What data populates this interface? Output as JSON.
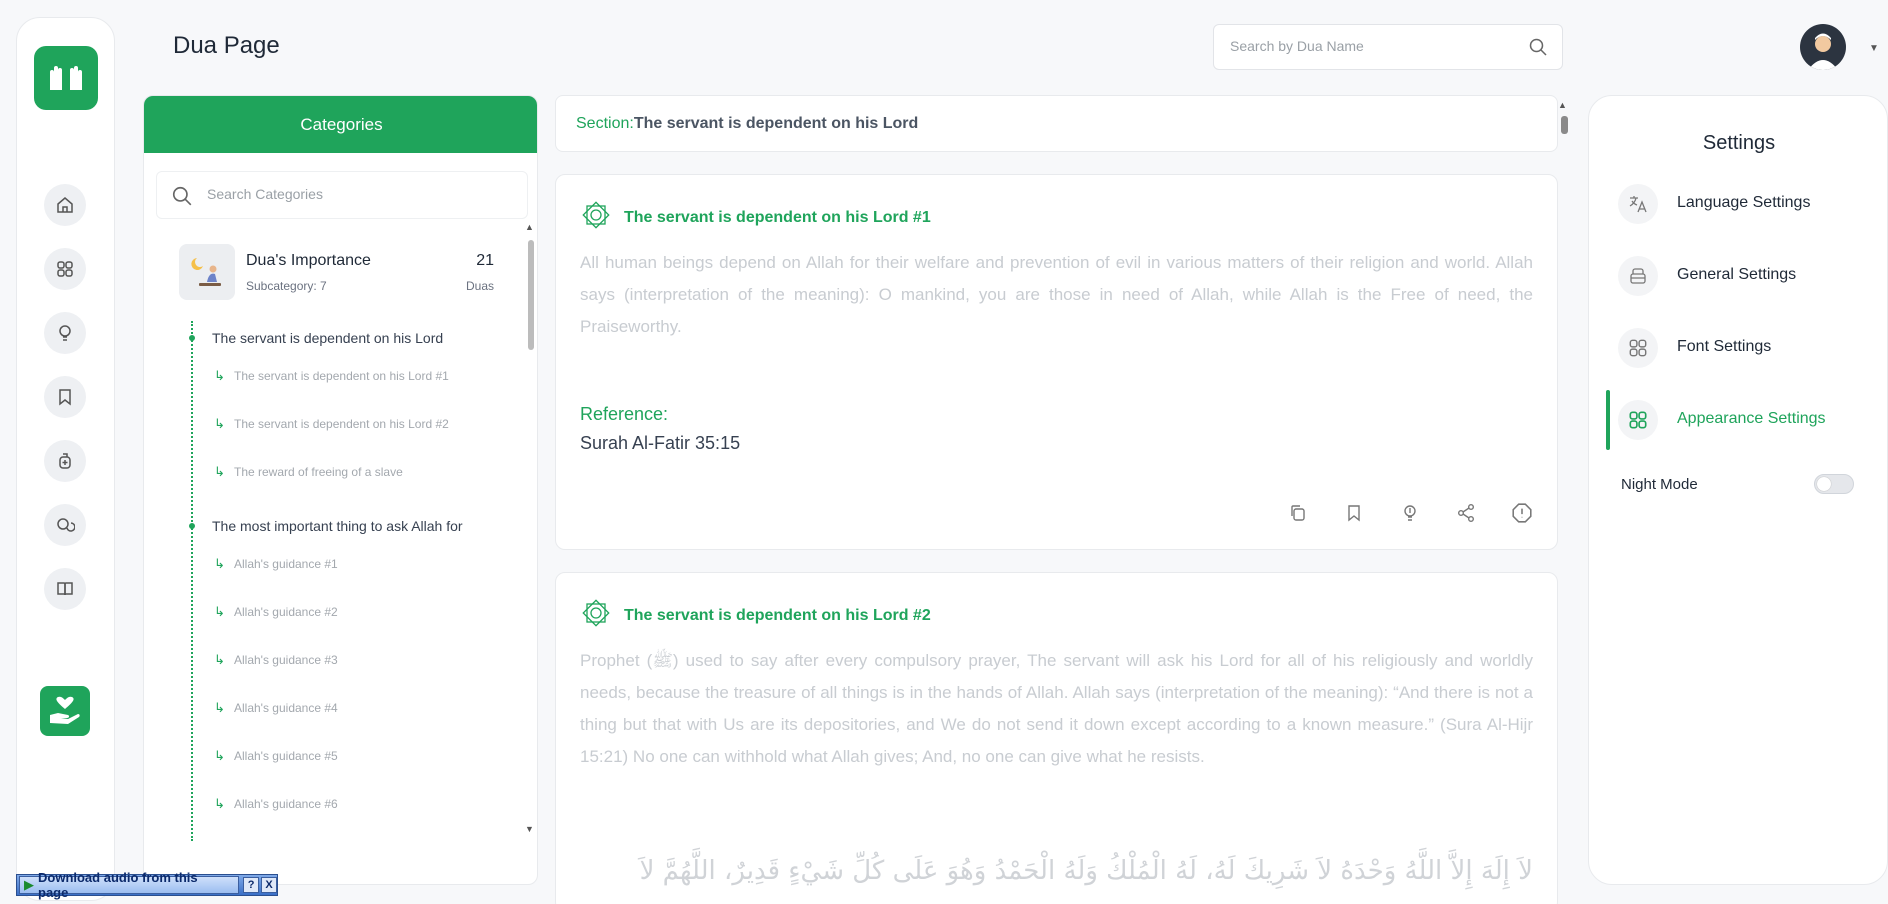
{
  "header": {
    "title": "Dua Page",
    "search_placeholder": "Search by Dua Name"
  },
  "left_nav": {
    "items": [
      {
        "name": "home-icon"
      },
      {
        "name": "grid-icon"
      },
      {
        "name": "bulb-icon"
      },
      {
        "name": "bookmark-icon"
      },
      {
        "name": "ruqyah-icon"
      },
      {
        "name": "chat-icon"
      },
      {
        "name": "book-icon"
      }
    ]
  },
  "categories": {
    "header": "Categories",
    "search_placeholder": "Search Categories",
    "item": {
      "name": "Dua's Importance",
      "subcategory": "Subcategory: 7",
      "count": "21",
      "count_label": "Duas"
    },
    "subcategories": [
      {
        "title": "The servant is dependent on his Lord",
        "duas": [
          "The servant is dependent on his Lord #1",
          "The servant is dependent on his Lord #2",
          "The reward of freeing of a slave"
        ]
      },
      {
        "title": "The most important thing to ask Allah for",
        "duas": [
          "Allah's guidance #1",
          "Allah's guidance #2",
          "Allah's guidance #3",
          "Allah's guidance #4",
          "Allah's guidance #5",
          "Allah's guidance #6"
        ]
      }
    ]
  },
  "section": {
    "label": "Section:",
    "value": "The servant is dependent on his Lord"
  },
  "cards": [
    {
      "title": "The servant is dependent on his Lord #1",
      "text": "All human beings depend on Allah for their welfare and prevention of evil in various matters of their religion and world. Allah says (interpretation of the meaning): O mankind, you are those in need of Allah, while Allah is the Free of need, the Praiseworthy.",
      "reference_label": "Reference:",
      "reference": "Surah Al-Fatir 35:15"
    },
    {
      "title": "The servant is dependent on his Lord #2",
      "text": "Prophet (ﷺ) used to say after every compulsory prayer, The servant will ask his Lord for all of his religiously and worldly needs, because the treasure of all things is in the hands of Allah. Allah says (interpretation of the meaning): “And there is not a thing but that with Us are its depositories, and We do not send it down except according to a known measure.” (Sura Al-Hijr 15:21) No one can withhold what Allah gives; And, no one can give what he resists.",
      "arabic": "لاَ إِلَهَ إِلاَّ اللَّهُ وَحْدَهُ لاَ شَرِيكَ لَهُ، لَهُ الْمُلْكُ وَلَهُ الْحَمْدُ وَهُوَ عَلَى كُلِّ شَيْءٍ قَدِيرٌ، اللَّهُمَّ لاَ"
    }
  ],
  "settings": {
    "title": "Settings",
    "items": [
      {
        "label": "Language Settings",
        "icon": "translate-icon"
      },
      {
        "label": "General Settings",
        "icon": "general-icon"
      },
      {
        "label": "Font Settings",
        "icon": "grid-icon"
      },
      {
        "label": "Appearance Settings",
        "icon": "grid-icon",
        "active": true
      }
    ],
    "night_mode_label": "Night Mode",
    "night_mode_on": false
  },
  "download_bar": {
    "label": "Download audio from this page",
    "help": "?",
    "close": "X"
  },
  "colors": {
    "brand": "#1fa45b",
    "background": "#f7f8fa"
  }
}
